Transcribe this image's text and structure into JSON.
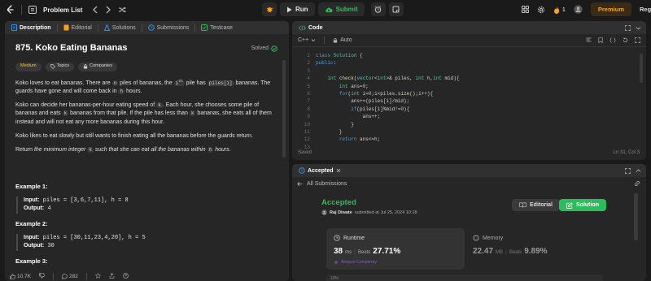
{
  "topbar": {
    "problem_list": "Problem List",
    "run": "Run",
    "submit": "Submit",
    "streak": "1",
    "premium": "Premium",
    "partial": "Reg"
  },
  "left_tabs": [
    "Description",
    "Editorial",
    "Solutions",
    "Submissions",
    "Testcase"
  ],
  "problem": {
    "title": "875. Koko Eating Bananas",
    "status": "Solved",
    "difficulty": "Medium",
    "topics": "Topics",
    "companies": "Companies",
    "p1": {
      "a": "Koko loves to eat bananas. There are ",
      "c1": "n",
      "b": " piles of bananas, the ",
      "c2": "i",
      "sup": "th",
      "c": " pile has ",
      "c3": "piles[i]",
      "d": " bananas. The guards have gone and will come back in ",
      "c4": "h",
      "e": " hours."
    },
    "p2": {
      "a": "Koko can decide her bananas-per-hour eating speed of ",
      "c1": "k",
      "b": ". Each hour, she chooses some pile of bananas and eats ",
      "c2": "k",
      "c": " bananas from that pile. If the pile has less than ",
      "c3": "k",
      "d": " bananas, she eats all of them instead and will not eat any more bananas during this hour."
    },
    "p3": "Koko likes to eat slowly but still wants to finish eating all the bananas before the guards return.",
    "p4": {
      "a": "Return ",
      "i1": "the minimum integer ",
      "c1": "k",
      "i2": " such that she can eat all the bananas within ",
      "c2": "h",
      "b": " hours."
    },
    "ex1_title": "Example 1:",
    "ex1_input": "piles = [3,6,7,11], h = 8",
    "ex1_output": "4",
    "ex2_title": "Example 2:",
    "ex2_input": "piles = [30,11,23,4,20], h = 5",
    "ex2_output": "30",
    "ex3_title": "Example 3:",
    "input_label": "Input:",
    "output_label": "Output:"
  },
  "left_footer": {
    "likes": "10.7K",
    "comments": "282"
  },
  "code_panel": {
    "title": "Code",
    "language": "C++",
    "auto": "Auto",
    "saved": "Saved",
    "position": "Ln 31, Col 3",
    "line_numbers": [
      "1",
      "2",
      "3",
      "4",
      "5",
      "6",
      "7",
      "8",
      "9",
      "10",
      "11",
      "12",
      "13"
    ],
    "lines": [
      "class Solution {",
      "public:",
      "",
      "    int check(vector<int>& piles, int h,int mid){",
      "        int ans=0;",
      "        for(int i=0;i<piles.size();i++){",
      "            ans+=(piles[i]/mid);",
      "            if(piles[i]%mid!=0){",
      "                ans++;",
      "            }",
      "        }",
      "        return ans<=h;",
      ""
    ]
  },
  "result_panel": {
    "tab": "Accepted",
    "all_submissions": "All Submissions",
    "status": "Accepted",
    "user": "Raj Diwate",
    "submitted": "submitted at Jul 25, 2024 10:18",
    "editorial": "Editorial",
    "solution": "Solution",
    "runtime_label": "Runtime",
    "runtime_value": "38",
    "runtime_unit": "ms",
    "beats_label": "Beats",
    "runtime_beats": "27.71%",
    "analyze": "Analyze Complexity",
    "memory_label": "Memory",
    "memory_value": "22.47",
    "memory_unit": "MB",
    "memory_beats": "9.89%",
    "partial_pct": "10%"
  },
  "colors": {
    "accent": "#ffa116",
    "success": "#2cbb5d",
    "bg": "#1a1a1a",
    "panel": "#262626"
  }
}
